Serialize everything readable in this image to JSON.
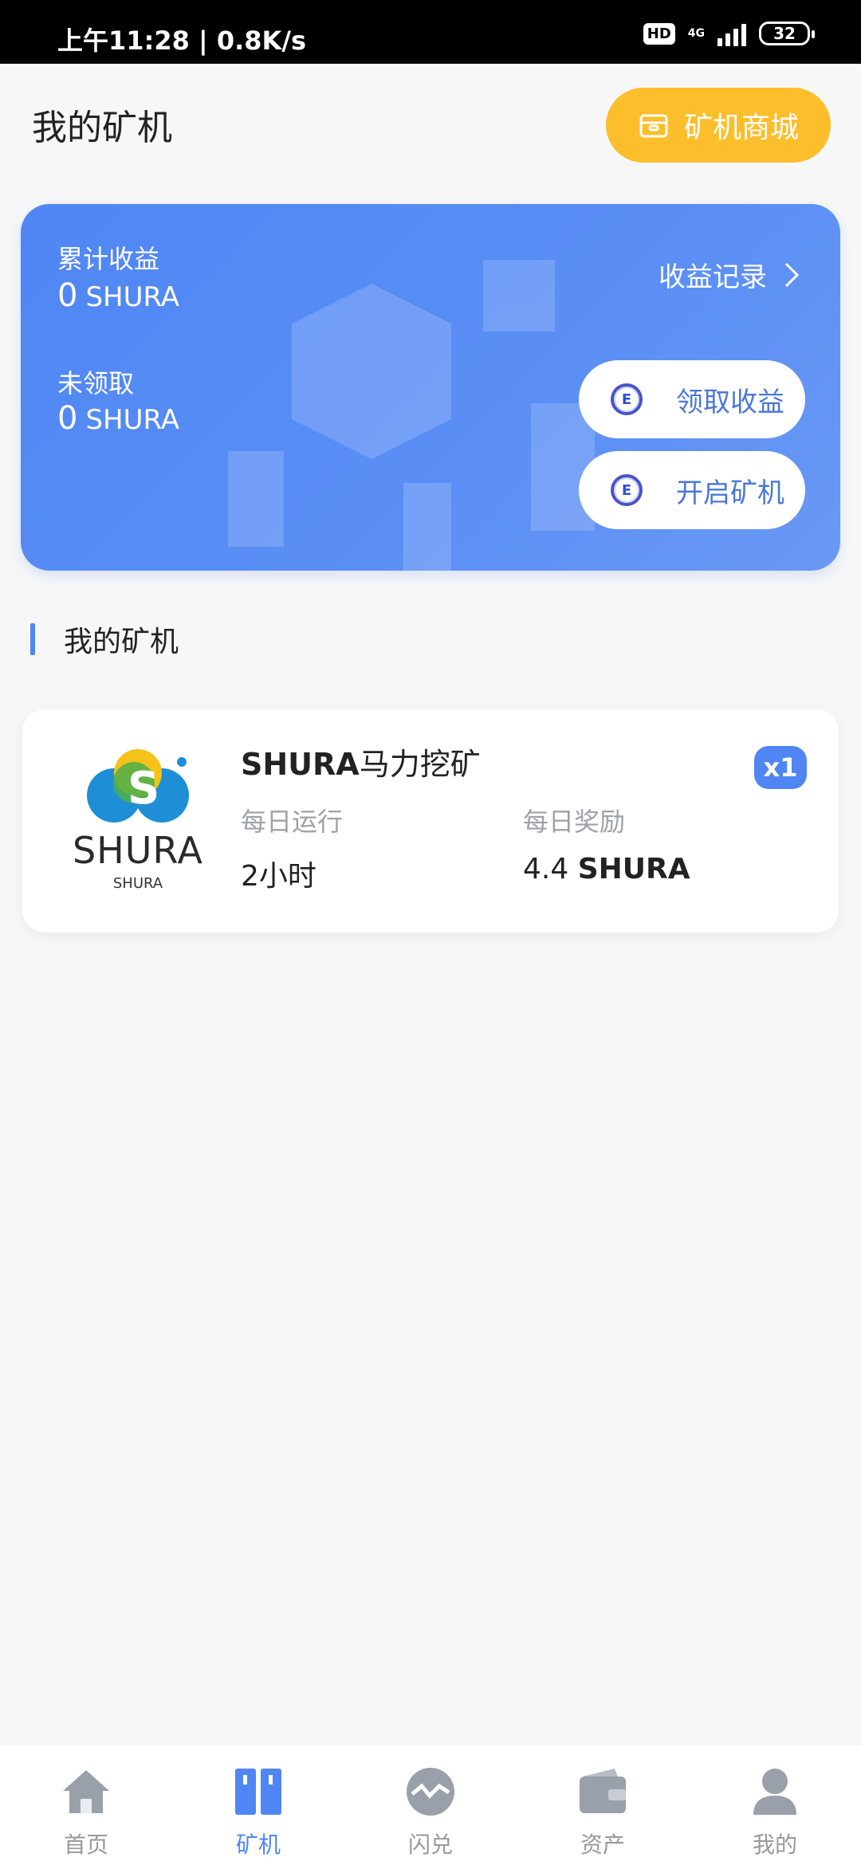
{
  "status_bar": {
    "time_speed": "上午11:28 | 0.8K/s",
    "hd": "HD",
    "network": "4G",
    "battery": "32"
  },
  "header": {
    "title": "我的矿机",
    "mall_button": "矿机商城",
    "mall_icon": "shop-icon"
  },
  "earnings": {
    "total_label": "累计收益",
    "total_value": "0",
    "total_unit": "SHURA",
    "unclaimed_label": "未领取",
    "unclaimed_value": "0",
    "unclaimed_unit": "SHURA",
    "record_link": "收益记录",
    "claim_button": "领取收益",
    "start_button": "开启矿机",
    "accent": "#4f86f4"
  },
  "section": {
    "title": "我的矿机"
  },
  "miner": {
    "logo_brand": "SHURA",
    "logo_sub": "SHURA",
    "name_latin": "SHURA",
    "name_cn": "马力挖矿",
    "count": "x1",
    "daily_run_label": "每日运行",
    "daily_run_value": "2小时",
    "daily_reward_label": "每日奖励",
    "daily_reward_number": "4.4",
    "daily_reward_unit": "SHURA"
  },
  "tabbar": {
    "tabs": [
      {
        "label": "首页",
        "icon": "home-icon"
      },
      {
        "label": "矿机",
        "icon": "miner-icon",
        "active": true
      },
      {
        "label": "闪兑",
        "icon": "exchange-icon"
      },
      {
        "label": "资产",
        "icon": "wallet-icon"
      },
      {
        "label": "我的",
        "icon": "profile-icon"
      }
    ]
  }
}
